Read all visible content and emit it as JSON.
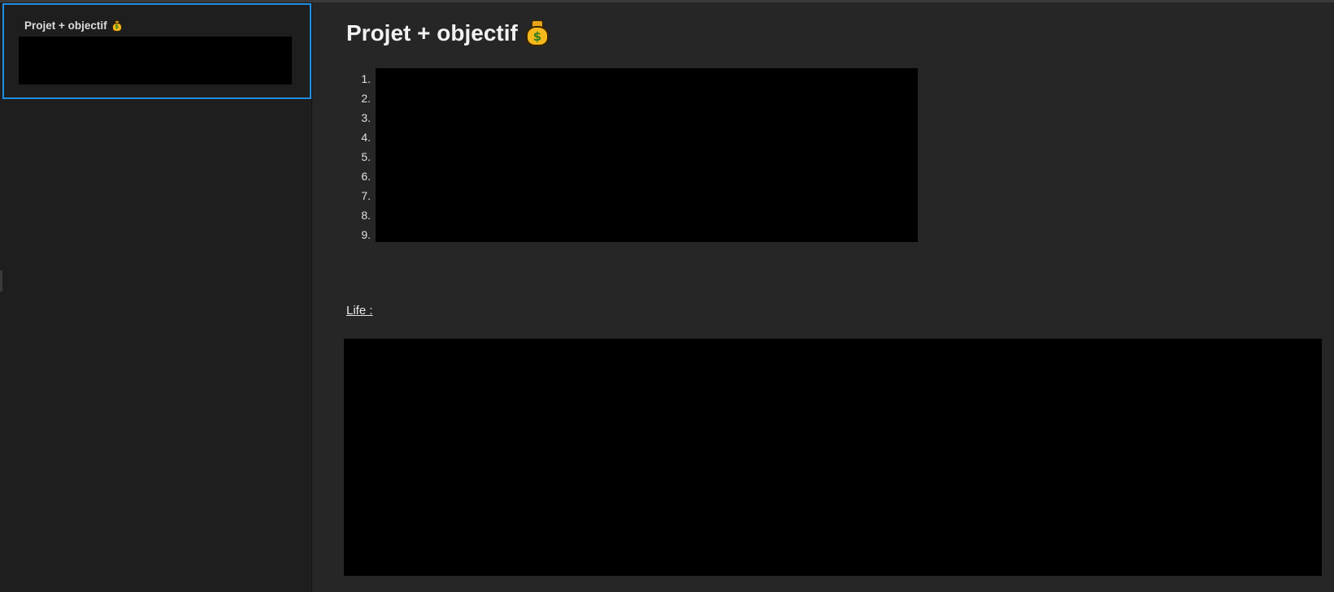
{
  "sidebar": {
    "notes": [
      {
        "title": "Projet + objectif",
        "icon": "money-bag-icon",
        "preview": ""
      }
    ],
    "selected_border_color": "#1e8fe0"
  },
  "note": {
    "title": "Projet + objectif",
    "title_icon": "money-bag-icon",
    "list_markers": [
      "1.",
      "2.",
      "3.",
      "4.",
      "5.",
      "6.",
      "7.",
      "8.",
      "9."
    ],
    "life_label": "Life :"
  },
  "colors": {
    "sidebar_bg": "#1e1e1e",
    "editor_bg": "#262626",
    "accent": "#1e8fe0",
    "redaction": "#000000"
  }
}
